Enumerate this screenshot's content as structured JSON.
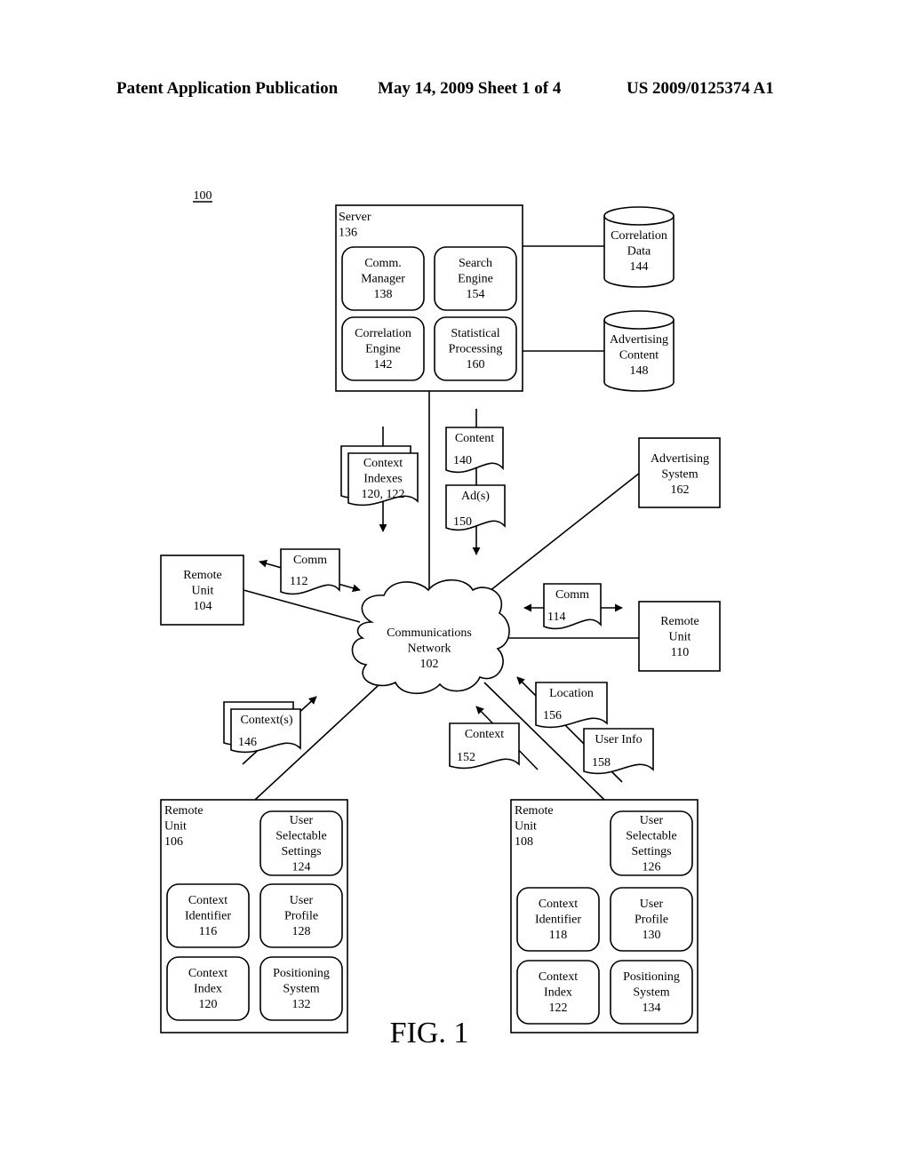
{
  "header": {
    "publication": "Patent Application Publication",
    "date_sheet": "May 14, 2009  Sheet 1 of 4",
    "number": "US 2009/0125374 A1"
  },
  "figure": {
    "ref": "100",
    "caption": "FIG. 1"
  },
  "server": {
    "label": [
      "Server",
      "136"
    ],
    "modules": [
      {
        "lines": [
          "Comm.",
          "Manager",
          "138"
        ]
      },
      {
        "lines": [
          "Search",
          "Engine",
          "154"
        ]
      },
      {
        "lines": [
          "Correlation",
          "Engine",
          "142"
        ]
      },
      {
        "lines": [
          "Statistical",
          "Processing",
          "160"
        ]
      }
    ]
  },
  "databases": [
    {
      "lines": [
        "Correlation",
        "Data",
        "144"
      ]
    },
    {
      "lines": [
        "Advertising",
        "Content",
        "148"
      ]
    }
  ],
  "documents": {
    "context_indexes": {
      "lines": [
        "Context",
        "Indexes",
        "120, 122"
      ]
    },
    "content": {
      "title": "Content",
      "num": "140"
    },
    "ads": {
      "title": "Ad(s)",
      "num": "150"
    },
    "comm_112": {
      "title": "Comm",
      "num": "112"
    },
    "comm_114": {
      "title": "Comm",
      "num": "114"
    },
    "contexts_146": {
      "title": "Context(s)",
      "num": "146"
    },
    "context_152": {
      "title": "Context",
      "num": "152"
    },
    "location_156": {
      "title": "Location",
      "num": "156"
    },
    "user_info_158": {
      "title": "User Info",
      "num": "158"
    }
  },
  "advertising_system": {
    "lines": [
      "Advertising",
      "System",
      "162"
    ]
  },
  "network": {
    "lines": [
      "Communications",
      "Network",
      "102"
    ]
  },
  "remote_unit_104": {
    "lines": [
      "Remote",
      "Unit",
      "104"
    ]
  },
  "remote_unit_110": {
    "lines": [
      "Remote",
      "Unit",
      "110"
    ]
  },
  "remote_unit_106": {
    "label": [
      "Remote",
      "Unit",
      "106"
    ],
    "modules": [
      {
        "lines": [
          "User",
          "Selectable",
          "Settings",
          "124"
        ]
      },
      {
        "lines": [
          "Context",
          "Identifier",
          "116"
        ]
      },
      {
        "lines": [
          "User",
          "Profile",
          "128"
        ]
      },
      {
        "lines": [
          "Context",
          "Index",
          "120"
        ]
      },
      {
        "lines": [
          "Positioning",
          "System",
          "132"
        ]
      }
    ]
  },
  "remote_unit_108": {
    "label": [
      "Remote",
      "Unit",
      "108"
    ],
    "modules": [
      {
        "lines": [
          "User",
          "Selectable",
          "Settings",
          "126"
        ]
      },
      {
        "lines": [
          "Context",
          "Identifier",
          "118"
        ]
      },
      {
        "lines": [
          "User",
          "Profile",
          "130"
        ]
      },
      {
        "lines": [
          "Context",
          "Index",
          "122"
        ]
      },
      {
        "lines": [
          "Positioning",
          "System",
          "134"
        ]
      }
    ]
  }
}
